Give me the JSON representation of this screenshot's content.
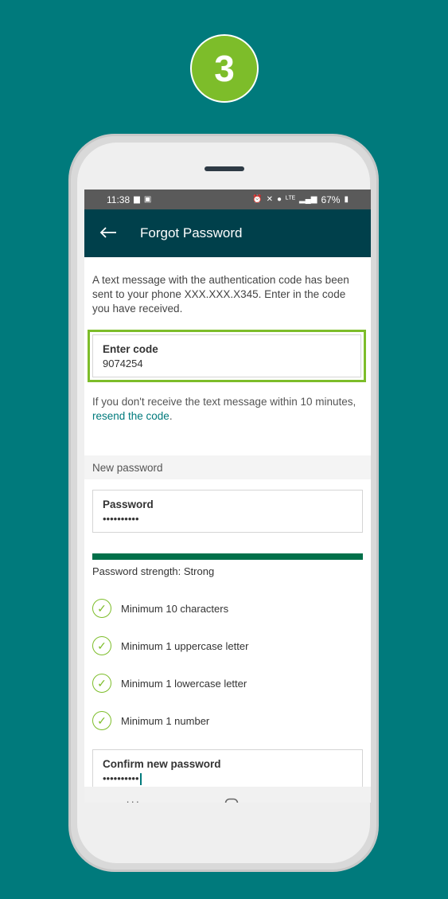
{
  "step_number": "3",
  "status_bar": {
    "time": "11:38",
    "battery": "67%",
    "left_icons": [
      "message-icon",
      "image-icon"
    ],
    "right_icons": [
      "alarm-icon",
      "mute-icon",
      "location-icon",
      "lte-icon",
      "signal-icon",
      "battery-icon"
    ]
  },
  "app_bar": {
    "title": "Forgot Password"
  },
  "intro_text": "A text message with the authentication code has been sent to your phone XXX.XXX.X345. Enter in the code you have received.",
  "code_field": {
    "label": "Enter code",
    "value": "9074254"
  },
  "help": {
    "text": "If you don't receive the text message within 10 minutes, ",
    "link": "resend the code",
    "suffix": "."
  },
  "new_password_section": {
    "heading": "New password",
    "password_label": "Password",
    "password_value": "••••••••••",
    "strength_label": "Password strength: Strong",
    "strength_fraction": 1.0,
    "strength_color": "#00704a",
    "rules": [
      "Minimum 10 characters",
      "Minimum 1 uppercase letter",
      "Minimum 1 lowercase letter",
      "Minimum 1 number"
    ],
    "confirm_label": "Confirm new password",
    "confirm_value": "••••••••••"
  },
  "colors": {
    "background": "#007a7c",
    "accent_green": "#7dbd2a",
    "app_bar": "#00404b",
    "link": "#007a7c"
  },
  "nav_bar": {
    "recents": "|||",
    "home": "○",
    "back": "‹"
  }
}
